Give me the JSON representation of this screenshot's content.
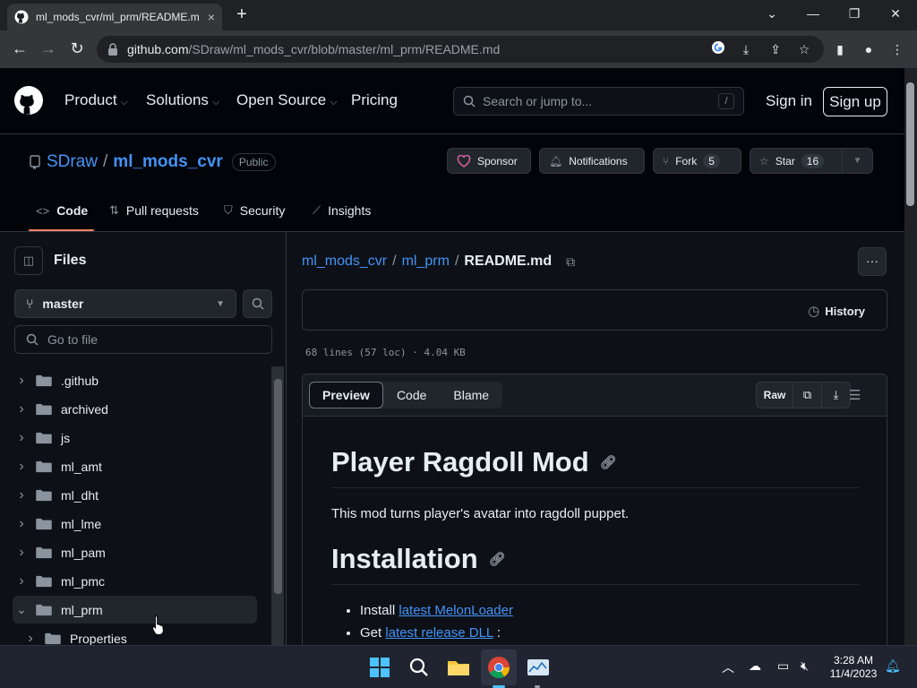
{
  "browser": {
    "tab_title": "ml_mods_cvr/ml_prm/README.m",
    "tab_close": "×",
    "new_tab": "+",
    "url_host": "github.com",
    "url_path": "/SDraw/ml_mods_cvr/blob/master/ml_prm/README.md"
  },
  "gh_header": {
    "nav": [
      "Product",
      "Solutions",
      "Open Source",
      "Pricing"
    ],
    "search_placeholder": "Search or jump to...",
    "search_key": "/",
    "signin": "Sign in",
    "signup": "Sign up"
  },
  "repo": {
    "owner": "SDraw",
    "sep": "/",
    "name": "ml_mods_cvr",
    "visibility": "Public",
    "sponsor": "Sponsor",
    "notifications": "Notifications",
    "fork": "Fork",
    "fork_count": "5",
    "star": "Star",
    "star_count": "16",
    "tabs": [
      "Code",
      "Pull requests",
      "Security",
      "Insights"
    ]
  },
  "sidebar": {
    "title": "Files",
    "branch": "master",
    "goto_placeholder": "Go to file",
    "tree": [
      {
        "name": ".github",
        "expanded": false,
        "depth": 0
      },
      {
        "name": "archived",
        "expanded": false,
        "depth": 0
      },
      {
        "name": "js",
        "expanded": false,
        "depth": 0
      },
      {
        "name": "ml_amt",
        "expanded": false,
        "depth": 0
      },
      {
        "name": "ml_dht",
        "expanded": false,
        "depth": 0
      },
      {
        "name": "ml_lme",
        "expanded": false,
        "depth": 0
      },
      {
        "name": "ml_pam",
        "expanded": false,
        "depth": 0
      },
      {
        "name": "ml_pmc",
        "expanded": false,
        "depth": 0
      },
      {
        "name": "ml_prm",
        "expanded": true,
        "depth": 0
      },
      {
        "name": "Properties",
        "expanded": false,
        "depth": 1
      }
    ]
  },
  "main": {
    "crumb1": "ml_mods_cvr",
    "crumb2": "ml_prm",
    "crumb_sep": "/",
    "current": "README.md",
    "history": "History",
    "file_info": "68 lines (57 loc) · 4.04 KB",
    "view_tabs": [
      "Preview",
      "Code",
      "Blame"
    ],
    "raw": "Raw",
    "readme": {
      "h1": "Player Ragdoll Mod",
      "intro": "This mod turns player's avatar into ragdoll puppet.",
      "h2": "Installation",
      "item1_text": "Install ",
      "item1_link": "latest MelonLoader",
      "item2_text": "Get ",
      "item2_link": "latest release DLL",
      "item2_after": ":"
    }
  },
  "taskbar": {
    "time": "3:28 AM",
    "date": "11/4/2023"
  },
  "colors": {
    "accent_link": "#4493f8",
    "tab_underline": "#f78166",
    "sponsor_heart": "#db61a2"
  }
}
